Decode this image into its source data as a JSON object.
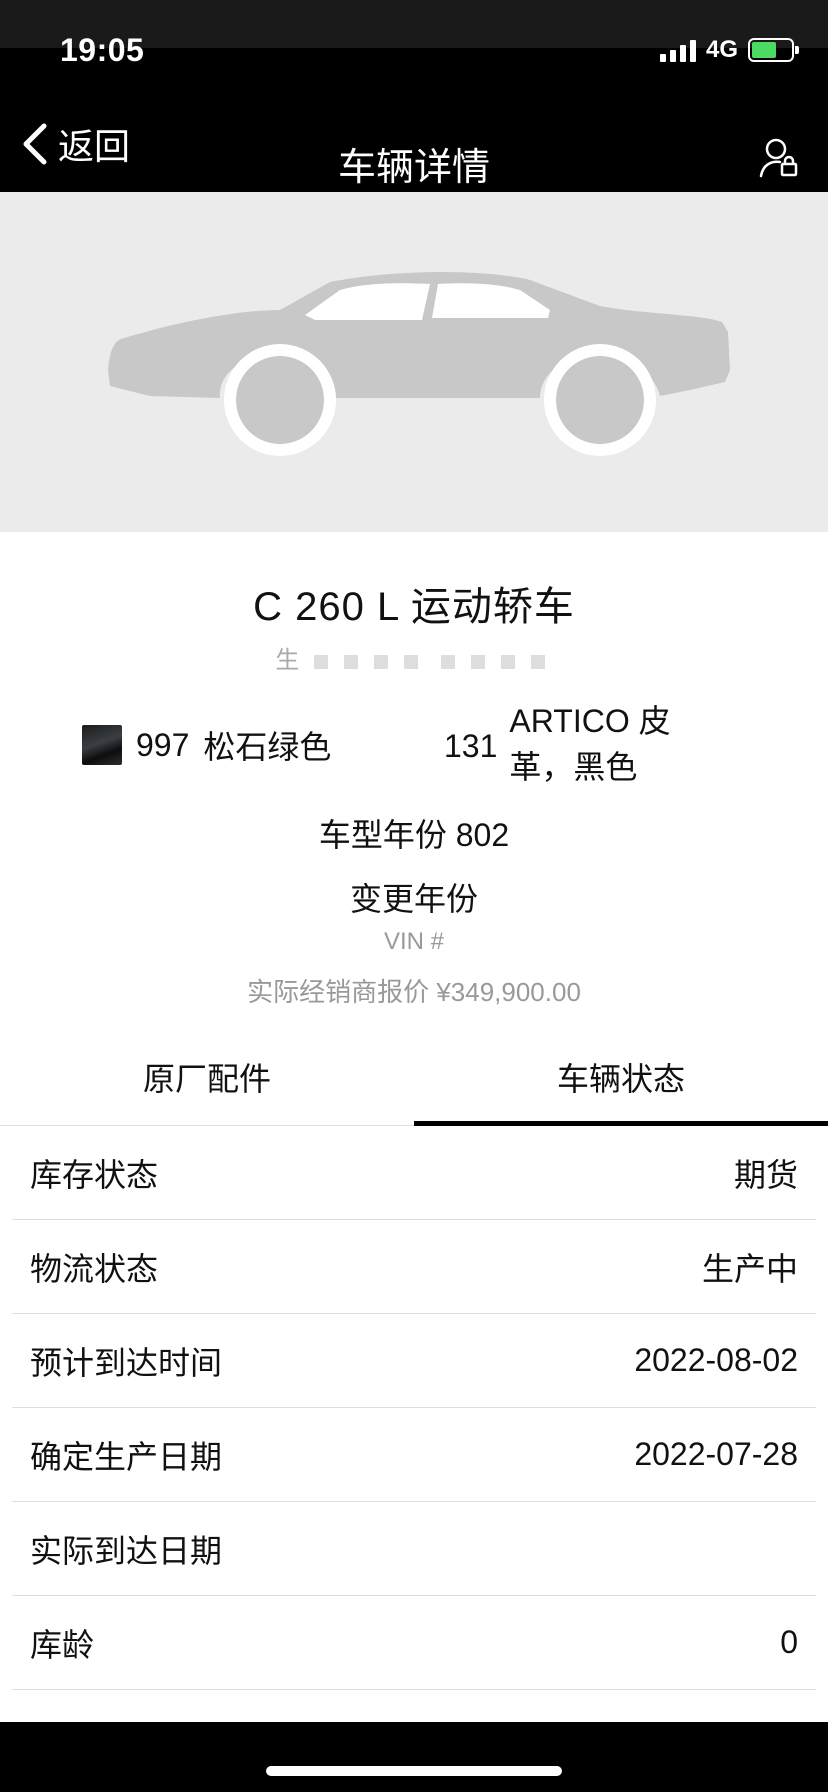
{
  "status_bar": {
    "time": "19:05",
    "network": "4G",
    "battery_color": "#4cd964"
  },
  "nav": {
    "back_label": "返回",
    "title": "车辆详情",
    "user_icon": "user-settings-icon"
  },
  "vehicle": {
    "model": "C 260 L 运动轿车",
    "production_prefix": "生",
    "paint_code": "997",
    "paint_name": "松石绿色",
    "upholstery_code": "131",
    "upholstery_name": "ARTICO 皮革，黑色",
    "model_year": "车型年份 802",
    "change_year": "变更年份",
    "vin": "VIN #",
    "price": "实际经销商报价 ¥349,900.00"
  },
  "tabs": [
    {
      "label": "原厂配件",
      "active": false
    },
    {
      "label": "车辆状态",
      "active": true
    }
  ],
  "status_rows": [
    {
      "label": "库存状态",
      "value": "期货"
    },
    {
      "label": "物流状态",
      "value": "生产中"
    },
    {
      "label": "预计到达时间",
      "value": "2022-08-02"
    },
    {
      "label": "确定生产日期",
      "value": "2022-07-28"
    },
    {
      "label": "实际到达日期",
      "value": ""
    },
    {
      "label": "库龄",
      "value": "0"
    }
  ]
}
